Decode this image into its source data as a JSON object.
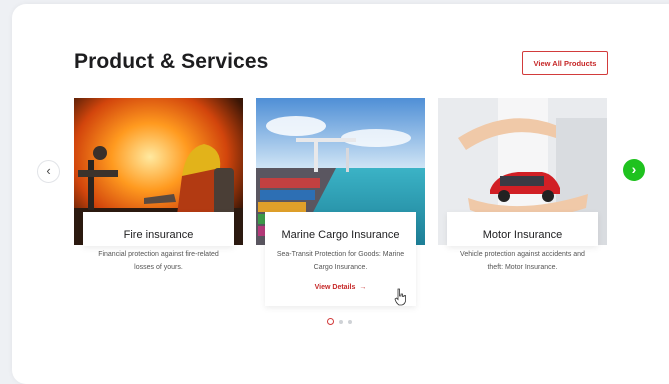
{
  "section": {
    "title": "Product & Services",
    "view_all_label": "View All Products"
  },
  "cards": [
    {
      "title": "Fire insurance",
      "description": "Financial protection against fire-related losses of yours.",
      "image_icon": "firefighter-image"
    },
    {
      "title": "Marine Cargo Insurance",
      "description": "Sea-Transit Protection for Goods: Marine Cargo Insurance.",
      "link_label": "View Details",
      "link_arrow": "→",
      "image_icon": "cargo-port-image"
    },
    {
      "title": "Motor Insurance",
      "description": "Vehicle protection against accidents and theft: Motor Insurance.",
      "image_icon": "car-hands-image"
    }
  ],
  "carousel": {
    "prev_icon": "‹",
    "next_icon": "›",
    "active_dot": 1,
    "dot_count": 3
  },
  "colors": {
    "accent": "#c62828",
    "next_button": "#1fc21f"
  }
}
